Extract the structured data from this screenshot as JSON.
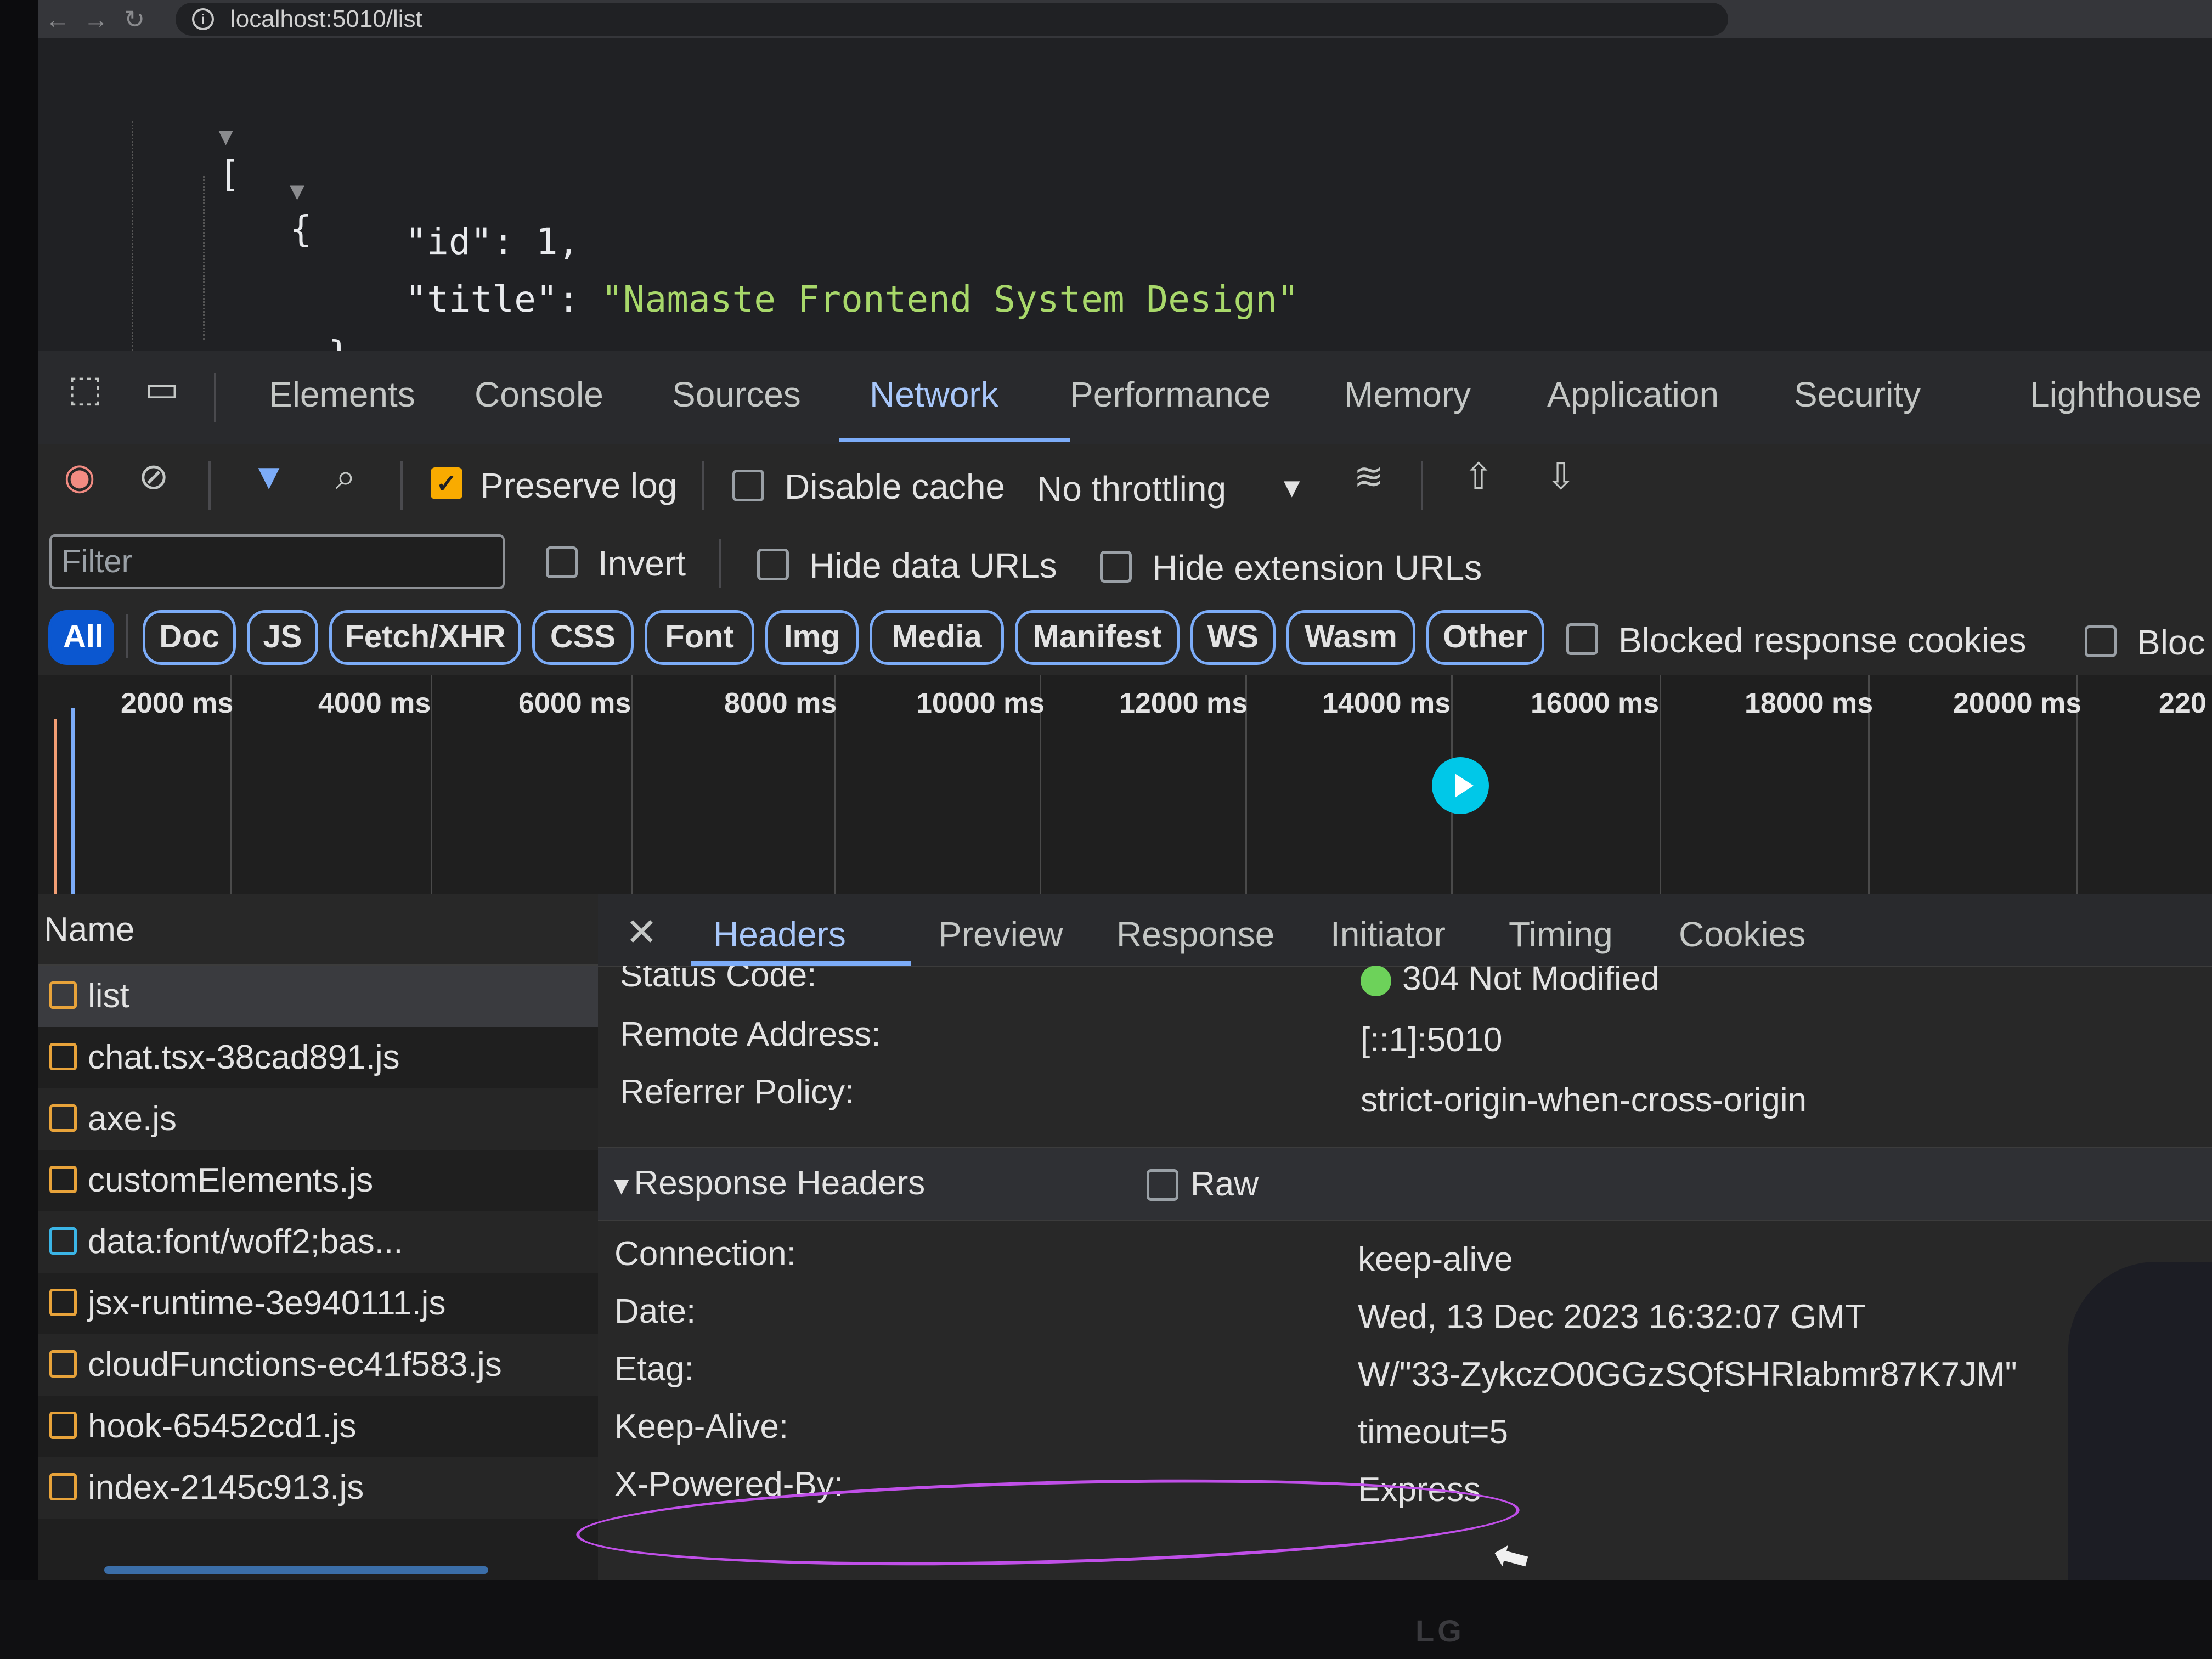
{
  "browser": {
    "url": "localhost:5010/list"
  },
  "json_view": {
    "open_bracket": "[",
    "open_brace": "{",
    "id_key": "\"id\"",
    "id_value": "1",
    "title_key": "\"title\"",
    "title_value": "\"Namaste Frontend System Design\"",
    "close_brace": "}"
  },
  "devtools": {
    "tabs": [
      "Elements",
      "Console",
      "Sources",
      "Network",
      "Performance",
      "Memory",
      "Application",
      "Security",
      "Lighthouse"
    ],
    "active_tab": "Network",
    "toolbar": {
      "preserve_log": "Preserve log",
      "preserve_log_checked": true,
      "disable_cache": "Disable cache",
      "throttling": "No throttling"
    },
    "filter": {
      "placeholder": "Filter",
      "invert": "Invert",
      "hide_data_urls": "Hide data URLs",
      "hide_extension_urls": "Hide extension URLs"
    },
    "type_filters": [
      "All",
      "Doc",
      "JS",
      "Fetch/XHR",
      "CSS",
      "Font",
      "Img",
      "Media",
      "Manifest",
      "WS",
      "Wasm",
      "Other"
    ],
    "active_type": "All",
    "blocked_response_cookies": "Blocked response cookies",
    "blocked_requests_truncated": "Bloc",
    "timeline_ticks": [
      "2000 ms",
      "4000 ms",
      "6000 ms",
      "8000 ms",
      "10000 ms",
      "12000 ms",
      "14000 ms",
      "16000 ms",
      "18000 ms",
      "20000 ms",
      "220"
    ],
    "name_column": "Name",
    "requests": [
      {
        "name": "list",
        "type": "fetch"
      },
      {
        "name": "chat.tsx-38cad891.js",
        "type": "js"
      },
      {
        "name": "axe.js",
        "type": "js"
      },
      {
        "name": "customElements.js",
        "type": "js"
      },
      {
        "name": "data:font/woff2;bas...",
        "type": "font"
      },
      {
        "name": "jsx-runtime-3e940111.js",
        "type": "js"
      },
      {
        "name": "cloudFunctions-ec41f583.js",
        "type": "js"
      },
      {
        "name": "hook-65452cd1.js",
        "type": "js"
      },
      {
        "name": "index-2145c913.js",
        "type": "js"
      }
    ],
    "selected_request": "list",
    "detail_tabs": [
      "Headers",
      "Preview",
      "Response",
      "Initiator",
      "Timing",
      "Cookies"
    ],
    "active_detail_tab": "Headers",
    "general": [
      {
        "key": "Status Code:",
        "value": "304 Not Modified"
      },
      {
        "key": "Remote Address:",
        "value": "[::1]:5010"
      },
      {
        "key": "Referrer Policy:",
        "value": "strict-origin-when-cross-origin"
      }
    ],
    "response_headers_title": "Response Headers",
    "raw_label": "Raw",
    "response_headers": [
      {
        "key": "Connection:",
        "value": "keep-alive"
      },
      {
        "key": "Date:",
        "value": "Wed, 13 Dec 2023 16:32:07 GMT"
      },
      {
        "key": "Etag:",
        "value": "W/\"33-ZykczO0GGzSQfSHRlabmr87K7JM\""
      },
      {
        "key": "Keep-Alive:",
        "value": "timeout=5"
      },
      {
        "key": "X-Powered-By:",
        "value": "Express"
      }
    ]
  },
  "monitor_brand": "LG",
  "colors": {
    "accent": "#7cacf8",
    "active_chip": "#0b57d0",
    "json_string": "#a8d86a",
    "status_ok": "#6dd25a",
    "annotation": "#c04fe8",
    "checkbox_checked": "#f9ab00"
  }
}
